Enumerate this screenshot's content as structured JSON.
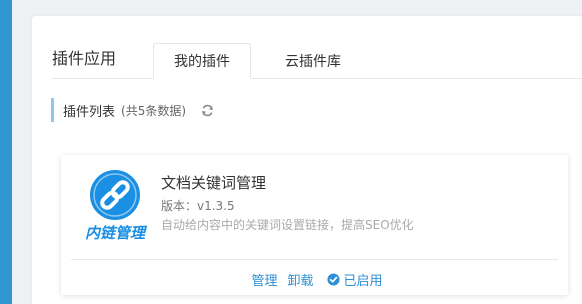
{
  "panel": {
    "title": "插件应用",
    "tabs": [
      {
        "label": "我的插件",
        "active": true
      },
      {
        "label": "云插件库",
        "active": false
      }
    ]
  },
  "section": {
    "title": "插件列表",
    "count": "(共5条数据)",
    "refresh_icon": "refresh-icon"
  },
  "plugin": {
    "logo_text": "内链管理",
    "logo_icon": "chain-link-icon",
    "name": "文档关键词管理",
    "version": "版本：v1.3.5",
    "description": "自动给内容中的关键词设置链接，提高SEO优化",
    "actions": {
      "manage": "管理",
      "uninstall": "卸载",
      "status": "已启用"
    }
  },
  "colors": {
    "accent": "#2d8fd5",
    "side_strip": "#2f96d3",
    "logo_blue": "#1a8fe3"
  }
}
